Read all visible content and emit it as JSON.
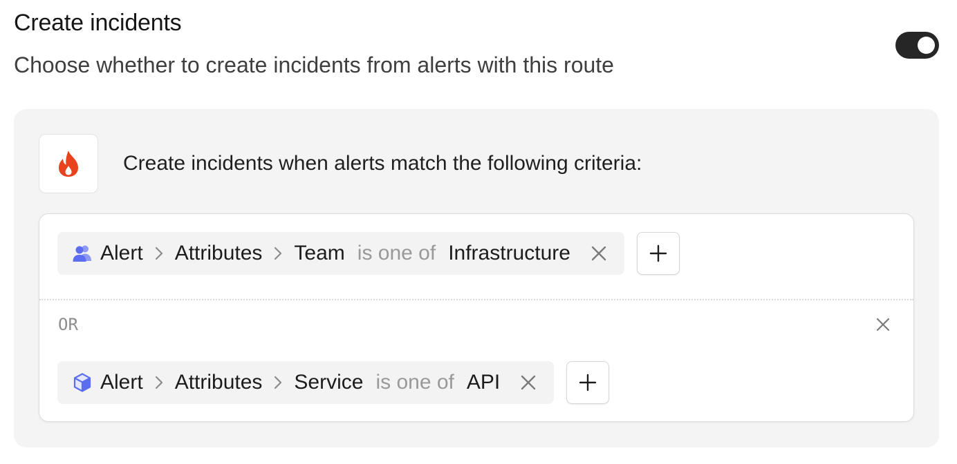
{
  "header": {
    "title": "Create incidents",
    "description": "Choose whether to create incidents from alerts with this route"
  },
  "toggle": {
    "state": "on"
  },
  "panel": {
    "icon": "flame-icon",
    "heading": "Create incidents when alerts match the following criteria:"
  },
  "groups": [
    {
      "condition": {
        "icon": "team-icon",
        "path": [
          "Alert",
          "Attributes",
          "Team"
        ],
        "operator": "is one of",
        "value": "Infrastructure"
      }
    },
    {
      "separator": "OR",
      "condition": {
        "icon": "cube-icon",
        "path": [
          "Alert",
          "Attributes",
          "Service"
        ],
        "operator": "is one of",
        "value": "API"
      }
    }
  ],
  "colors": {
    "accent_icon": "#5b6ef0",
    "flame": "#e8421e",
    "toggle_on": "#262626"
  }
}
